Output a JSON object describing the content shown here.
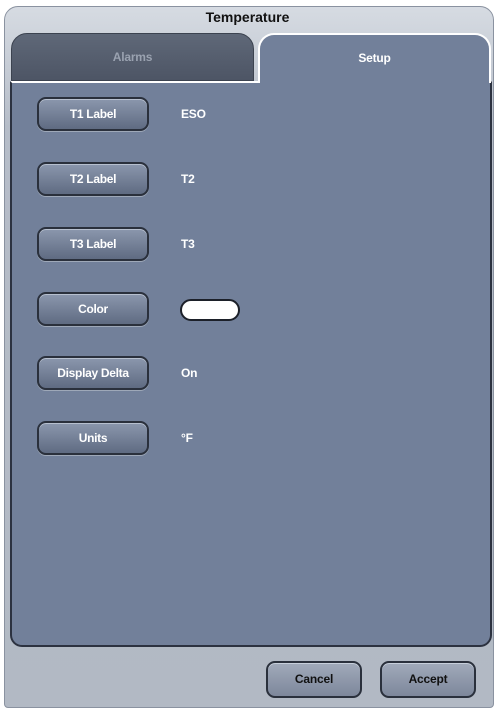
{
  "window": {
    "title": "Temperature"
  },
  "tabs": [
    {
      "label": "Alarms",
      "active": false
    },
    {
      "label": "Setup",
      "active": true
    }
  ],
  "settings": [
    {
      "label": "T1 Label",
      "value": "ESO"
    },
    {
      "label": "T2 Label",
      "value": "T2"
    },
    {
      "label": "T3 Label",
      "value": "T3"
    },
    {
      "label": "Color",
      "value": "",
      "swatch_color": "#ffffff"
    },
    {
      "label": "Display Delta",
      "value": "On"
    },
    {
      "label": "Units",
      "value": "°F"
    }
  ],
  "footer": {
    "cancel_label": "Cancel",
    "accept_label": "Accept"
  },
  "colors": {
    "panel": "#72809a",
    "inactive_tab": "#4d5565",
    "button_border": "#2a303c"
  }
}
